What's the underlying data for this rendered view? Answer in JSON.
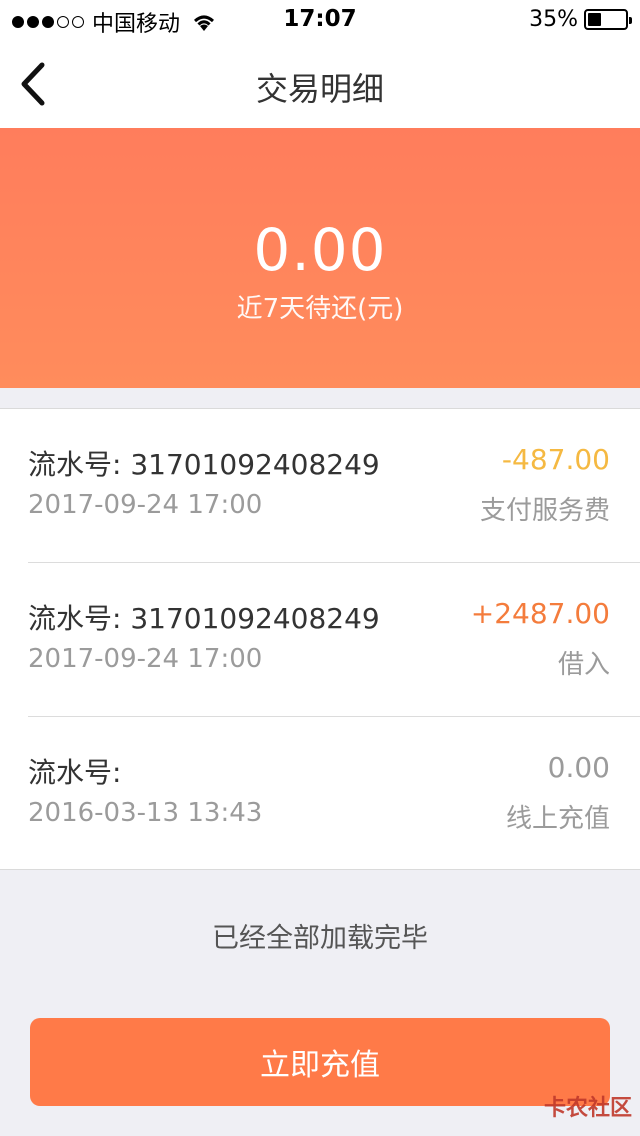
{
  "status_bar": {
    "carrier": "中国移动",
    "time": "17:07",
    "battery_percent": "35%"
  },
  "nav": {
    "title": "交易明细"
  },
  "summary": {
    "amount": "0.00",
    "label": "近7天待还(元)"
  },
  "transactions": [
    {
      "serial": "流水号: 31701092408249",
      "date": "2017-09-24 17:00",
      "amount": "-487.00",
      "amount_color": "#f5b942",
      "type": "支付服务费"
    },
    {
      "serial": "流水号: 31701092408249",
      "date": "2017-09-24 17:00",
      "amount": "+2487.00",
      "amount_color": "#f47c3c",
      "type": "借入"
    },
    {
      "serial": "流水号:",
      "date": "2016-03-13 13:43",
      "amount": "0.00",
      "amount_color": "#9b9b9b",
      "type": "线上充值"
    }
  ],
  "footer": {
    "loaded_all": "已经全部加载完毕"
  },
  "action": {
    "recharge_label": "立即充值"
  },
  "watermark": {
    "text": "卡农社区"
  }
}
